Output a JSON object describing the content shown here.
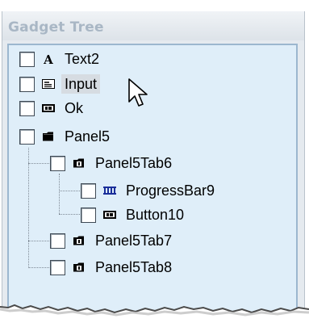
{
  "header": {
    "title": "Gadget Tree"
  },
  "tree": {
    "items": [
      {
        "label": "Text2",
        "icon": "text-icon"
      },
      {
        "label": "Input",
        "icon": "input-icon"
      },
      {
        "label": "Ok",
        "icon": "button-icon"
      },
      {
        "label": "Panel5",
        "icon": "folder-icon"
      },
      {
        "label": "Panel5Tab6",
        "icon": "tab-folder-icon"
      },
      {
        "label": "ProgressBar9",
        "icon": "progressbar-icon"
      },
      {
        "label": "Button10",
        "icon": "button-icon"
      },
      {
        "label": "Panel5Tab7",
        "icon": "tab-folder-icon"
      },
      {
        "label": "Panel5Tab8",
        "icon": "tab-folder-icon"
      }
    ],
    "selected": "Input"
  },
  "colors": {
    "tree_bg": "#dfeef9",
    "header_text": "#a9b7c5",
    "border": "#9cb7cf"
  }
}
